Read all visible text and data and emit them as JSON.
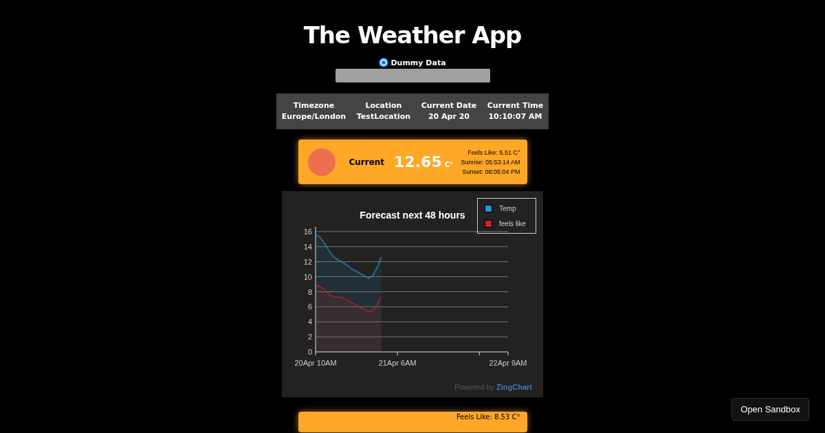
{
  "title": "The Weather App",
  "data_source": {
    "label": "Dummy Data",
    "selected": true
  },
  "info": [
    {
      "heading": "Timezone",
      "value": "Europe/London"
    },
    {
      "heading": "Location",
      "value": "TestLocation"
    },
    {
      "heading": "Current Date",
      "value": "20 Apr 20"
    },
    {
      "heading": "Current Time",
      "value": "10:10:07 AM"
    }
  ],
  "current": {
    "label": "Current",
    "temp": "12.65",
    "unit": "C°",
    "feels_like": "Feels Like: 5.51 C°",
    "sunrise": "Sunrise: 05:53:14 AM",
    "sunset": "Sunset: 08:05:04 PM"
  },
  "chart": {
    "powered_by": "Powered by",
    "brand": "ZingChart",
    "chart_data": {
      "type": "area",
      "title": "Forecast next 48 hours",
      "grid": true,
      "legend": "top-right",
      "categories": [
        "20Apr 10AM",
        null,
        null,
        null,
        null,
        null,
        null,
        null,
        null,
        null,
        null,
        null,
        null,
        null,
        null,
        null,
        null,
        null,
        null,
        null,
        "21Apr 6AM",
        null,
        null,
        null,
        null,
        null,
        null,
        null,
        null,
        null,
        null,
        null,
        null,
        null,
        null,
        null,
        null,
        null,
        null,
        null,
        null,
        null,
        null,
        null,
        null,
        null,
        null,
        "22Apr 9AM"
      ],
      "ylim": [
        0,
        16
      ],
      "yticks": [
        0,
        2,
        4,
        6,
        8,
        10,
        12,
        14,
        16
      ],
      "series": [
        {
          "name": "Temp",
          "color": "#2596d1",
          "values": [
            15.6,
            15.3,
            14.6,
            13.7,
            12.9,
            12.4,
            12.1,
            11.8,
            11.4,
            11.0,
            10.7,
            10.4,
            10.1,
            9.8,
            10.2,
            11.2,
            12.6,
            null,
            null,
            null,
            null,
            null,
            null,
            null,
            null,
            null,
            null,
            null,
            null,
            null,
            null,
            null,
            null,
            null,
            null,
            null,
            null,
            null,
            null,
            null,
            null,
            null,
            null,
            null,
            null,
            null,
            null,
            null
          ]
        },
        {
          "name": "feels like",
          "color": "#d42020",
          "values": [
            8.9,
            8.7,
            8.4,
            7.8,
            7.4,
            7.3,
            7.3,
            7.1,
            6.8,
            6.5,
            6.2,
            5.9,
            5.6,
            5.4,
            5.5,
            6.3,
            7.3,
            null,
            null,
            null,
            null,
            null,
            null,
            null,
            null,
            null,
            null,
            null,
            null,
            null,
            null,
            null,
            null,
            null,
            null,
            null,
            null,
            null,
            null,
            null,
            null,
            null,
            null,
            null,
            null,
            null,
            null,
            null
          ]
        }
      ]
    }
  },
  "next_card": {
    "feels_like": "Feels Like: 8.53 C°"
  },
  "sandbox_button": "Open Sandbox"
}
